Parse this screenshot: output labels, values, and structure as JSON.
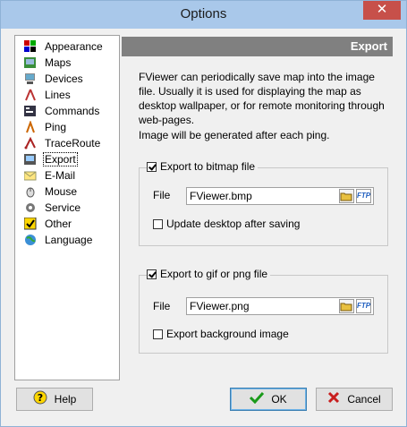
{
  "window": {
    "title": "Options",
    "close_glyph": "✕"
  },
  "sidebar": {
    "items": [
      {
        "label": "Appearance",
        "icon": "appearance-icon"
      },
      {
        "label": "Maps",
        "icon": "maps-icon"
      },
      {
        "label": "Devices",
        "icon": "devices-icon"
      },
      {
        "label": "Lines",
        "icon": "lines-icon"
      },
      {
        "label": "Commands",
        "icon": "commands-icon"
      },
      {
        "label": "Ping",
        "icon": "ping-icon"
      },
      {
        "label": "TraceRoute",
        "icon": "traceroute-icon"
      },
      {
        "label": "Export",
        "icon": "export-icon",
        "selected": true
      },
      {
        "label": "E-Mail",
        "icon": "email-icon"
      },
      {
        "label": "Mouse",
        "icon": "mouse-icon"
      },
      {
        "label": "Service",
        "icon": "service-icon"
      },
      {
        "label": "Other",
        "icon": "other-icon"
      },
      {
        "label": "Language",
        "icon": "language-icon"
      }
    ]
  },
  "panel": {
    "title": "Export",
    "description": "FViewer can periodically save map into the image file. Usually it is used for displaying the map as desktop wallpaper, or for remote monitoring through web-pages.",
    "note": "Image will be generated after each ping.",
    "bitmap_group": {
      "checkbox_label": "Export to bitmap file",
      "checked": true,
      "file_label": "File",
      "file_value": "FViewer.bmp",
      "option_label": "Update desktop after saving",
      "option_checked": false
    },
    "gif_group": {
      "checkbox_label": "Export to gif or png file",
      "checked": true,
      "file_label": "File",
      "file_value": "FViewer.png",
      "option_label": "Export background image",
      "option_checked": false
    },
    "ftp_label": "FTP"
  },
  "buttons": {
    "help": "Help",
    "ok": "OK",
    "cancel": "Cancel"
  }
}
